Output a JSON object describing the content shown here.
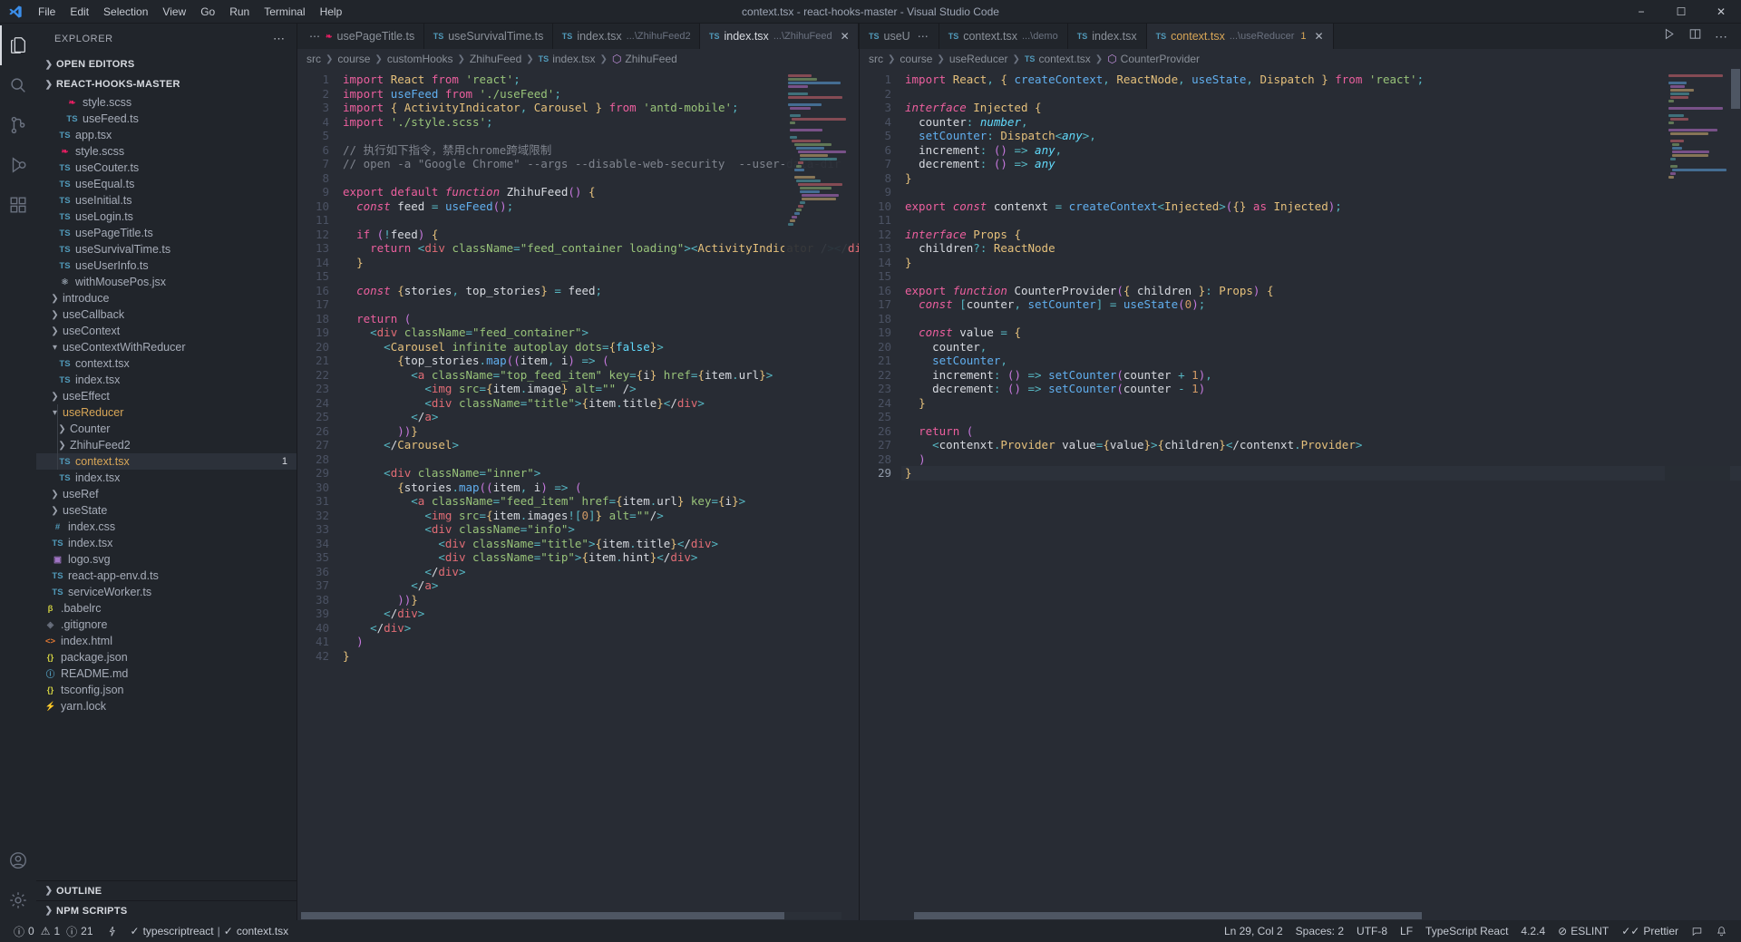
{
  "titlebar": {
    "title": "context.tsx - react-hooks-master - Visual Studio Code",
    "menus": [
      "File",
      "Edit",
      "Selection",
      "View",
      "Go",
      "Run",
      "Terminal",
      "Help"
    ],
    "minimize": "−",
    "maximize": "☐",
    "close": "✕"
  },
  "activitybar": {
    "items": [
      {
        "name": "explorer",
        "icon": "files-icon"
      },
      {
        "name": "search",
        "icon": "search-icon"
      },
      {
        "name": "source-control",
        "icon": "source-control-icon"
      },
      {
        "name": "run-debug",
        "icon": "run-debug-icon"
      },
      {
        "name": "extensions",
        "icon": "extensions-icon"
      }
    ],
    "bottom": [
      {
        "name": "accounts",
        "icon": "account-icon"
      },
      {
        "name": "settings",
        "icon": "gear-icon"
      }
    ]
  },
  "sidebar": {
    "title": "EXPLORER",
    "overflow": "⋯",
    "open_editors": "OPEN EDITORS",
    "project": "REACT-HOOKS-MASTER",
    "outline": "OUTLINE",
    "npm_scripts": "NPM SCRIPTS",
    "tree": [
      {
        "label": "style.scss",
        "kind": "scss",
        "depth": 4,
        "type": "file"
      },
      {
        "label": "useFeed.ts",
        "kind": "ts",
        "depth": 4,
        "type": "file"
      },
      {
        "label": "app.tsx",
        "kind": "ts",
        "depth": 3,
        "type": "file"
      },
      {
        "label": "style.scss",
        "kind": "scss",
        "depth": 3,
        "type": "file"
      },
      {
        "label": "useCouter.ts",
        "kind": "ts",
        "depth": 3,
        "type": "file"
      },
      {
        "label": "useEqual.ts",
        "kind": "ts",
        "depth": 3,
        "type": "file"
      },
      {
        "label": "useInitial.ts",
        "kind": "ts",
        "depth": 3,
        "type": "file"
      },
      {
        "label": "useLogin.ts",
        "kind": "ts",
        "depth": 3,
        "type": "file"
      },
      {
        "label": "usePageTitle.ts",
        "kind": "ts",
        "depth": 3,
        "type": "file"
      },
      {
        "label": "useSurvivalTime.ts",
        "kind": "ts",
        "depth": 3,
        "type": "file"
      },
      {
        "label": "useUserInfo.ts",
        "kind": "ts",
        "depth": 3,
        "type": "file"
      },
      {
        "label": "withMousePos.jsx",
        "kind": "jsx",
        "depth": 3,
        "type": "file"
      },
      {
        "label": "introduce",
        "kind": "dir",
        "depth": 2,
        "type": "folder",
        "expanded": false
      },
      {
        "label": "useCallback",
        "kind": "dir",
        "depth": 2,
        "type": "folder",
        "expanded": false
      },
      {
        "label": "useContext",
        "kind": "dir",
        "depth": 2,
        "type": "folder",
        "expanded": false
      },
      {
        "label": "useContextWithReducer",
        "kind": "dir",
        "depth": 2,
        "type": "folder",
        "expanded": true
      },
      {
        "label": "context.tsx",
        "kind": "ts",
        "depth": 3,
        "type": "file"
      },
      {
        "label": "index.tsx",
        "kind": "ts",
        "depth": 3,
        "type": "file"
      },
      {
        "label": "useEffect",
        "kind": "dir",
        "depth": 2,
        "type": "folder",
        "expanded": false
      },
      {
        "label": "useReducer",
        "kind": "dir",
        "depth": 2,
        "type": "folder",
        "expanded": true,
        "modified": true
      },
      {
        "label": "Counter",
        "kind": "dir",
        "depth": 3,
        "type": "folder",
        "expanded": false
      },
      {
        "label": "ZhihuFeed2",
        "kind": "dir",
        "depth": 3,
        "type": "folder",
        "expanded": false
      },
      {
        "label": "context.tsx",
        "kind": "ts",
        "depth": 3,
        "type": "file",
        "selected": true,
        "modified": true,
        "badge": "1"
      },
      {
        "label": "index.tsx",
        "kind": "ts",
        "depth": 3,
        "type": "file"
      },
      {
        "label": "useRef",
        "kind": "dir",
        "depth": 2,
        "type": "folder",
        "expanded": false
      },
      {
        "label": "useState",
        "kind": "dir",
        "depth": 2,
        "type": "folder",
        "expanded": false
      },
      {
        "label": "index.css",
        "kind": "css",
        "depth": 2,
        "type": "file"
      },
      {
        "label": "index.tsx",
        "kind": "ts",
        "depth": 2,
        "type": "file"
      },
      {
        "label": "logo.svg",
        "kind": "svg",
        "depth": 2,
        "type": "file"
      },
      {
        "label": "react-app-env.d.ts",
        "kind": "ts",
        "depth": 2,
        "type": "file"
      },
      {
        "label": "serviceWorker.ts",
        "kind": "ts",
        "depth": 2,
        "type": "file"
      },
      {
        "label": ".babelrc",
        "kind": "babel",
        "depth": 1,
        "type": "file"
      },
      {
        "label": ".gitignore",
        "kind": "git",
        "depth": 1,
        "type": "file"
      },
      {
        "label": "index.html",
        "kind": "html",
        "depth": 1,
        "type": "file"
      },
      {
        "label": "package.json",
        "kind": "json",
        "depth": 1,
        "type": "file"
      },
      {
        "label": "README.md",
        "kind": "md",
        "depth": 1,
        "type": "file"
      },
      {
        "label": "tsconfig.json",
        "kind": "json",
        "depth": 1,
        "type": "file"
      },
      {
        "label": "yarn.lock",
        "kind": "lock",
        "depth": 1,
        "type": "file"
      }
    ]
  },
  "editor_group_left": {
    "tabs": [
      {
        "icon": "scss-icon",
        "name": "usePageTitle.ts",
        "path": "",
        "active": false,
        "leading_dots": true
      },
      {
        "icon": "TS",
        "name": "useSurvivalTime.ts",
        "path": "",
        "active": false
      },
      {
        "icon": "TS",
        "name": "index.tsx",
        "path": "...\\ZhihuFeed2",
        "active": false
      },
      {
        "icon": "TS",
        "name": "index.tsx",
        "path": "...\\ZhihuFeed",
        "active": true,
        "close": "✕"
      }
    ],
    "breadcrumb": [
      "src",
      "course",
      "customHooks",
      "ZhihuFeed",
      "index.tsx",
      "ZhihuFeed"
    ],
    "breadcrumb_file_icon": "TS",
    "breadcrumb_symbol_icon": "cube-icon",
    "first_line": 1,
    "last_line": 42,
    "lines": [
      "import React from 'react';",
      "import useFeed from './useFeed';",
      "import { ActivityIndicator, Carousel } from 'antd-mobile';",
      "import './style.scss';",
      "",
      "// 执行如下指令，禁用chrome跨域限制",
      "// open -a \"Google Chrome\" --args --disable-web-security  --user-data-dir",
      "",
      "export default function ZhihuFeed() {",
      "  const feed = useFeed();",
      "",
      "  if (!feed) {",
      "    return <div className=\"feed_container loading\"><ActivityIndicator /></div>",
      "  }",
      "",
      "  const {stories, top_stories} = feed;",
      "",
      "  return (",
      "    <div className=\"feed_container\">",
      "      <Carousel infinite autoplay dots={false}>",
      "        {top_stories.map((item, i) => (",
      "          <a className=\"top_feed_item\" key={i} href={item.url}>",
      "            <img src={item.image} alt=\"\" />",
      "            <div className=\"title\">{item.title}</div>",
      "          </a>",
      "        ))}",
      "      </Carousel>",
      "",
      "      <div className=\"inner\">",
      "        {stories.map((item, i) => (",
      "          <a className=\"feed_item\" href={item.url} key={i}>",
      "            <img src={item.images![0]} alt=\"\"/>",
      "            <div className=\"info\">",
      "              <div className=\"title\">{item.title}</div>",
      "              <div className=\"tip\">{item.hint}</div>",
      "            </div>",
      "          </a>",
      "        ))}",
      "      </div>",
      "    </div>",
      "  )",
      "}"
    ]
  },
  "editor_group_right": {
    "tabs": [
      {
        "icon": "TS",
        "name": "useU",
        "path": "",
        "active": false,
        "trailing_dots": true
      },
      {
        "icon": "TS",
        "name": "context.tsx",
        "path": "...\\demo",
        "active": false
      },
      {
        "icon": "TS",
        "name": "index.tsx",
        "path": "",
        "active": false
      },
      {
        "icon": "TS",
        "name": "context.tsx",
        "path": "...\\useReducer",
        "active": true,
        "dirty": true,
        "badge": "1",
        "close": "✕"
      }
    ],
    "actions": [
      "run-icon",
      "split-editor-icon",
      "more-actions-icon"
    ],
    "breadcrumb": [
      "src",
      "course",
      "useReducer",
      "context.tsx",
      "CounterProvider"
    ],
    "breadcrumb_file_icon": "TS",
    "breadcrumb_symbol_icon": "cube-icon",
    "lines": [
      "import React, { createContext, ReactNode, useState, Dispatch } from 'react';",
      "",
      "interface Injected {",
      "  counter: number,",
      "  setCounter: Dispatch<any>,",
      "  increment: () => any,",
      "  decrement: () => any",
      "}",
      "",
      "export const contenxt = createContext<Injected>({} as Injected);",
      "",
      "interface Props {",
      "  children?: ReactNode",
      "}",
      "",
      "export function CounterProvider({ children }: Props) {",
      "  const [counter, setCounter] = useState(0);",
      "",
      "  const value = {",
      "    counter,",
      "    setCounter,",
      "    increment: () => setCounter(counter + 1),",
      "    decrement: () => setCounter(counter - 1)",
      "  }",
      "",
      "  return (",
      "    <contenxt.Provider value={value}>{children}</contenxt.Provider>",
      "  )",
      "}"
    ],
    "cursor_line": 29
  },
  "statusbar": {
    "errors": "0",
    "warnings": "1",
    "infos": "21",
    "radio_icon": "radio-tower-icon",
    "eslint_left": "typescriptreact",
    "eslint_file": "context.tsx",
    "position": "Ln 29, Col 2",
    "spaces": "Spaces: 2",
    "encoding": "UTF-8",
    "eol": "LF",
    "language": "TypeScript React",
    "version": "4.2.4",
    "eslint": "ESLINT",
    "prettier": "Prettier",
    "feedback_icon": "feedback-icon",
    "bell_icon": "bell-icon"
  }
}
